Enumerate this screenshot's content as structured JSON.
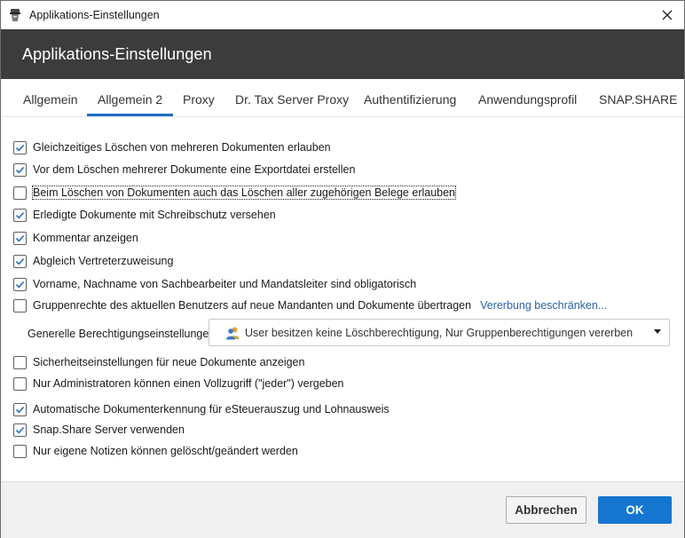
{
  "window": {
    "title": "Applikations-Einstellungen"
  },
  "header": {
    "title": "Applikations-Einstellungen"
  },
  "tabs": [
    {
      "label": "Allgemein",
      "active": false
    },
    {
      "label": "Allgemein 2",
      "active": true
    },
    {
      "label": "Proxy",
      "active": false
    },
    {
      "label": "Dr. Tax Server Proxy",
      "active": false
    },
    {
      "label": "Authentifizierung",
      "active": false
    },
    {
      "label": "Anwendungsprofil",
      "active": false
    },
    {
      "label": "SNAP.SHARE",
      "active": false
    }
  ],
  "options": [
    {
      "label": "Gleichzeitiges Löschen von mehreren Dokumenten erlauben",
      "checked": true
    },
    {
      "label": "Vor dem Löschen mehrerer Dokumente eine Exportdatei erstellen",
      "checked": true
    },
    {
      "label": "Beim Löschen von Dokumenten auch das Löschen aller zugehörigen Belege erlauben",
      "checked": false
    },
    {
      "label": "Erledigte Dokumente mit Schreibschutz versehen",
      "checked": true
    },
    {
      "label": "Kommentar anzeigen",
      "checked": true
    },
    {
      "label": "Abgleich Vertreterzuweisung",
      "checked": true
    },
    {
      "label": "Vorname, Nachname von Sachbearbeiter und Mandatsleiter sind obligatorisch",
      "checked": true
    },
    {
      "label": "Gruppenrechte des aktuellen Benutzers auf neue Mandanten und Dokumente übertragen",
      "checked": false
    },
    {
      "label": "Sicherheitseinstellungen für neue Dokumente anzeigen",
      "checked": false
    },
    {
      "label": "Nur Administratoren können einen Vollzugriff (\"jeder\") vergeben",
      "checked": false
    },
    {
      "label": "Automatische Dokumenterkennung für eSteuerauszug und Lohnausweis",
      "checked": true
    },
    {
      "label": "Snap.Share Server verwenden",
      "checked": true
    },
    {
      "label": "Nur eigene Notizen können gelöscht/geändert werden",
      "checked": false
    }
  ],
  "inheritance_link": "Vererbung beschränken...",
  "permissions": {
    "label": "Generelle Berechtigungseinstellungen",
    "selected": "User besitzen keine Löschberechtigung, Nur Gruppenberechtigungen vererben"
  },
  "footer": {
    "cancel_label": "Abbrechen",
    "ok_label": "OK"
  },
  "colors": {
    "header_bg": "#3c3c3c",
    "accent": "#1476d0",
    "link": "#2a62a8"
  },
  "icons": {
    "app": "app-icon",
    "close": "close-icon",
    "users": "users-icon",
    "dropdown": "chevron-down-icon",
    "check": "check-icon"
  }
}
